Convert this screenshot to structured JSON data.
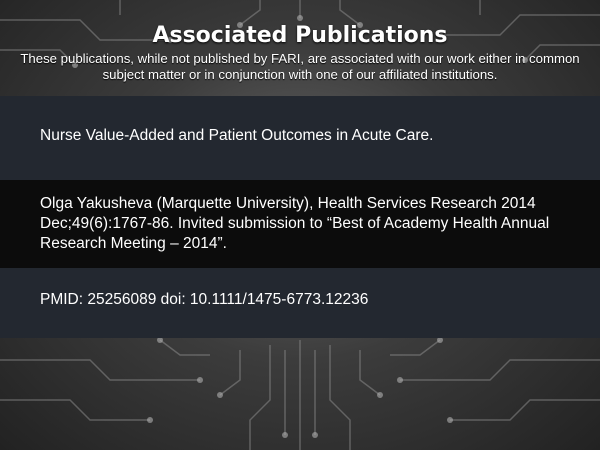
{
  "header": {
    "title": "Associated Publications",
    "subtitle": "These publications, while not published by FARI, are associated  with our work either in common subject matter or in conjunction with one of our affiliated institutions."
  },
  "publication": {
    "title": "Nurse Value-Added and Patient Outcomes in Acute Care.",
    "citation": "Olga Yakusheva (Marquette University), Health Services Research 2014 Dec;49(6):1767-86. Invited submission to “Best of Academy Health Annual Research Meeting – 2014”.",
    "identifiers": "PMID: 25256089 doi: 10.1111/1475-6773.12236"
  },
  "colors": {
    "panel_dark_blue": "#232830",
    "panel_black": "#0c0c0c",
    "text": "#ffffff"
  }
}
